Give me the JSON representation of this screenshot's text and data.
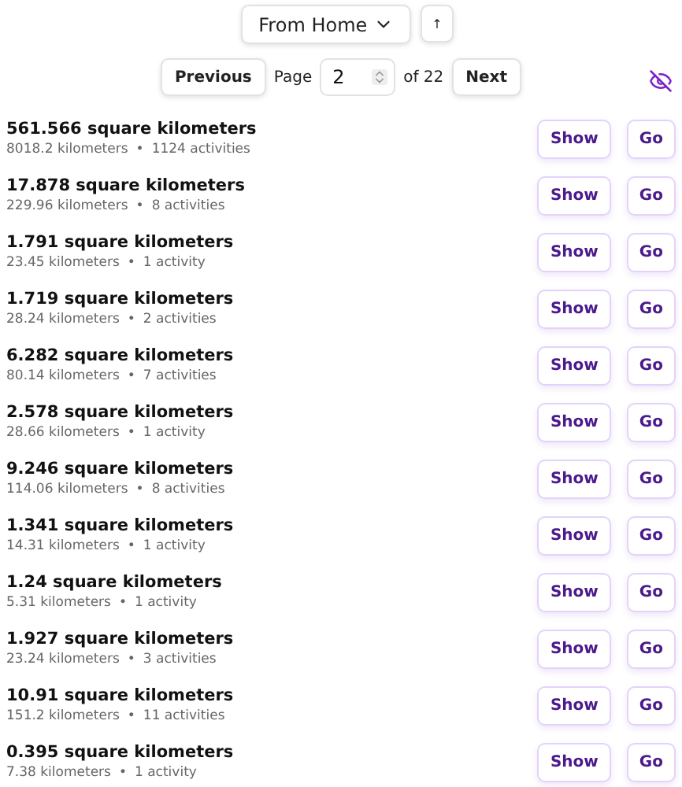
{
  "sort": {
    "label": "From Home",
    "direction_button": "↑"
  },
  "pager": {
    "previous": "Previous",
    "page_label": "Page",
    "page": "2",
    "of": "of 22",
    "next": "Next"
  },
  "rows": [
    {
      "area": "561.566 square kilometers",
      "distance": "8018.2 kilometers",
      "separator": "•",
      "activities": "1124 activities",
      "show": "Show",
      "go": "Go"
    },
    {
      "area": "17.878 square kilometers",
      "distance": "229.96 kilometers",
      "separator": "•",
      "activities": "8 activities",
      "show": "Show",
      "go": "Go"
    },
    {
      "area": "1.791 square kilometers",
      "distance": "23.45 kilometers",
      "separator": "•",
      "activities": "1 activity",
      "show": "Show",
      "go": "Go"
    },
    {
      "area": "1.719 square kilometers",
      "distance": "28.24 kilometers",
      "separator": "•",
      "activities": "2 activities",
      "show": "Show",
      "go": "Go"
    },
    {
      "area": "6.282 square kilometers",
      "distance": "80.14 kilometers",
      "separator": "•",
      "activities": "7 activities",
      "show": "Show",
      "go": "Go"
    },
    {
      "area": "2.578 square kilometers",
      "distance": "28.66 kilometers",
      "separator": "•",
      "activities": "1 activity",
      "show": "Show",
      "go": "Go"
    },
    {
      "area": "9.246 square kilometers",
      "distance": "114.06 kilometers",
      "separator": "•",
      "activities": "8 activities",
      "show": "Show",
      "go": "Go"
    },
    {
      "area": "1.341 square kilometers",
      "distance": "14.31 kilometers",
      "separator": "•",
      "activities": "1 activity",
      "show": "Show",
      "go": "Go"
    },
    {
      "area": "1.24 square kilometers",
      "distance": "5.31 kilometers",
      "separator": "•",
      "activities": "1 activity",
      "show": "Show",
      "go": "Go"
    },
    {
      "area": "1.927 square kilometers",
      "distance": "23.24 kilometers",
      "separator": "•",
      "activities": "3 activities",
      "show": "Show",
      "go": "Go"
    },
    {
      "area": "10.91 square kilometers",
      "distance": "151.2 kilometers",
      "separator": "•",
      "activities": "11 activities",
      "show": "Show",
      "go": "Go"
    },
    {
      "area": "0.395 square kilometers",
      "distance": "7.38 kilometers",
      "separator": "•",
      "activities": "1 activity",
      "show": "Show",
      "go": "Go"
    }
  ]
}
